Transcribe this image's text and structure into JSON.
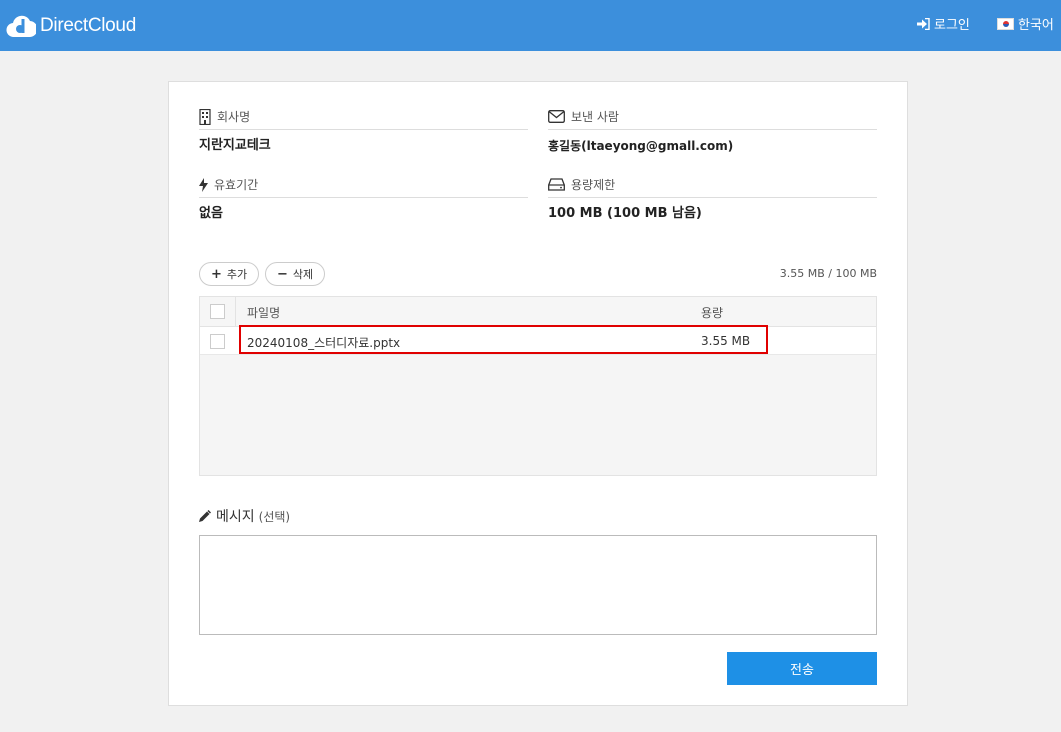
{
  "header": {
    "brand": "DirectCloud",
    "login_label": "로그인",
    "language_label": "한국어",
    "bg_color": "#3c8fdc"
  },
  "info": {
    "company_label": "회사명",
    "company_value": "지란지교테크",
    "sender_label": "보낸 사람",
    "sender_value": "홍길동(ltaeyong@gmall.com)",
    "expiry_label": "유효기간",
    "expiry_value": "없음",
    "capacity_label": "용량제한",
    "capacity_value": "100 MB (100 MB 남음)"
  },
  "toolbar": {
    "add_label": "추가",
    "delete_label": "삭제",
    "usage": "3.55 MB / 100 MB"
  },
  "file_table": {
    "columns": [
      "파일명",
      "용량"
    ],
    "rows": [
      {
        "name": "20240108_스터디자료.pptx",
        "size": "3.55 MB"
      }
    ]
  },
  "message": {
    "label": "메시지",
    "optional": "(선택)",
    "value": ""
  },
  "send_label": "전송",
  "accent_color": "#1e90e6",
  "highlight_color": "#e00000"
}
